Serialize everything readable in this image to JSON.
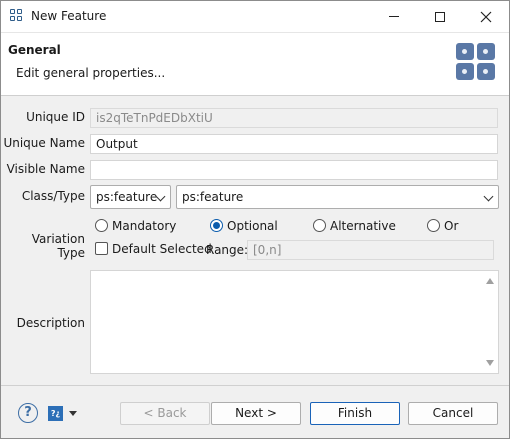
{
  "window": {
    "title": "New Feature",
    "icon": "feature-model-icon",
    "controls": [
      "minimize-icon",
      "maximize-icon",
      "close-icon"
    ]
  },
  "header": {
    "title": "General",
    "subtitle": "Edit general properties...",
    "logo": "feature-model-logo-icon"
  },
  "form": {
    "unique_id": {
      "label": "Unique ID",
      "value": "is2qTeTnPdEDbXtiU"
    },
    "unique_name": {
      "label": "Unique Name",
      "value": "Output"
    },
    "visible_name": {
      "label": "Visible Name",
      "value": ""
    },
    "class_type": {
      "label": "Class/Type",
      "class_value": "ps:feature",
      "type_value": "ps:feature"
    },
    "variation_type": {
      "label": "Variation Type",
      "options": [
        "Mandatory",
        "Optional",
        "Alternative",
        "Or"
      ],
      "selected": "Optional",
      "default_selected_label": "Default Selected",
      "default_selected_checked": false,
      "range_label": "Range:",
      "range_value": "[0,n]"
    },
    "description": {
      "label": "Description",
      "value": ""
    }
  },
  "footer": {
    "back_label": "< Back",
    "next_label": "Next >",
    "finish_label": "Finish",
    "cancel_label": "Cancel",
    "help_icon": "help-icon",
    "tip_icon": "dynamic-help-icon"
  },
  "colors": {
    "accent": "#0b5cad",
    "default_button_border": "#1a63b8",
    "logo": "#5a78a6"
  }
}
